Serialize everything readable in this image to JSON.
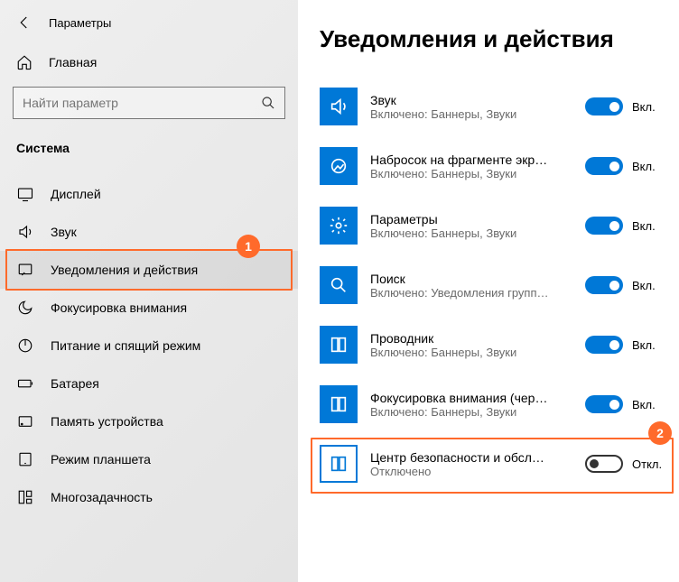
{
  "header": {
    "title": "Параметры"
  },
  "home": {
    "label": "Главная"
  },
  "search": {
    "placeholder": "Найти параметр"
  },
  "section": "Система",
  "nav": [
    {
      "label": "Дисплей"
    },
    {
      "label": "Звук"
    },
    {
      "label": "Уведомления и действия"
    },
    {
      "label": "Фокусировка внимания"
    },
    {
      "label": "Питание и спящий режим"
    },
    {
      "label": "Батарея"
    },
    {
      "label": "Память устройства"
    },
    {
      "label": "Режим планшета"
    },
    {
      "label": "Многозадачность"
    }
  ],
  "badge1": "1",
  "badge2": "2",
  "page_title": "Уведомления и действия",
  "toggle_on_label": "Вкл.",
  "toggle_off_label": "Откл.",
  "apps": [
    {
      "title": "Звук",
      "sub": "Включено: Баннеры, Звуки",
      "on": true
    },
    {
      "title": "Набросок на фрагменте экрана",
      "sub": "Включено: Баннеры, Звуки",
      "on": true
    },
    {
      "title": "Параметры",
      "sub": "Включено: Баннеры, Звуки",
      "on": true
    },
    {
      "title": "Поиск",
      "sub": "Включено: Уведомления группы…",
      "on": true
    },
    {
      "title": "Проводник",
      "sub": "Включено: Баннеры, Звуки",
      "on": true
    },
    {
      "title": "Фокусировка внимания (через…",
      "sub": "Включено: Баннеры, Звуки",
      "on": true
    },
    {
      "title": "Центр безопасности и обслужи…",
      "sub": "Отключено",
      "on": false
    }
  ]
}
